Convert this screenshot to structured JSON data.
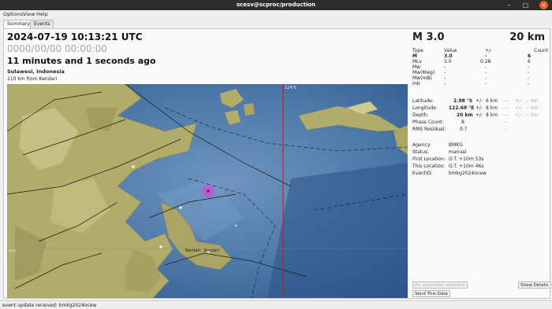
{
  "window": {
    "title": "scesv@scproc/production",
    "controls": {
      "minimize": "–",
      "maximize": "▢",
      "close": "×"
    }
  },
  "menu": {
    "items": [
      "Options",
      "View",
      "Help"
    ]
  },
  "tabs": [
    "Summary",
    "Events"
  ],
  "event": {
    "origin_time": "2024-07-19 10:13:21 UTC",
    "secondary_time": "0000/00/00  00:00:00",
    "elapsed": "11 minutes and 1 seconds ago",
    "region": "Sulawesi, Indonesia",
    "nearest_city": "110 km from Kendari"
  },
  "summary": {
    "magnitude_label": "M 3.0",
    "depth_label": "20 km"
  },
  "magnitudes": {
    "headers": {
      "type": "Type",
      "value": "Value",
      "pm": "+/-",
      "count": "Count"
    },
    "rows": [
      {
        "type": "M",
        "value": "3.0",
        "pm": "-",
        "count": "6",
        "bold": true
      },
      {
        "type": "MLv",
        "value": "3.0",
        "pm": "0.28",
        "count": "6",
        "bold": false
      },
      {
        "type": "Mw",
        "value": "-",
        "pm": "-",
        "count": "-",
        "bold": false
      },
      {
        "type": "Mw(Mwp)",
        "value": "-",
        "pm": "-",
        "count": "-",
        "bold": false
      },
      {
        "type": "Mw(mB)",
        "value": "-",
        "pm": "-",
        "count": "-",
        "bold": false
      },
      {
        "type": "mb",
        "value": "-",
        "pm": "-",
        "count": "-",
        "bold": false
      }
    ]
  },
  "origin_info": {
    "latitude": {
      "label": "Latitude:",
      "value": "2.98 °S",
      "pm": "+/-",
      "err": "6 km",
      "ref_value": "----",
      "ref_pm": "+/-",
      "ref_err": "-- km"
    },
    "longitude": {
      "label": "Longitude:",
      "value": "122.68 °E",
      "pm": "+/-",
      "err": "8 km",
      "ref_value": "----",
      "ref_pm": "+/-",
      "ref_err": "-- km"
    },
    "depth": {
      "label": "Depth:",
      "value": "20 km",
      "pm": "+/-",
      "err": "8 km",
      "ref_value": "----",
      "ref_pm": "+/-",
      "ref_err": "-- km"
    },
    "phase_count": {
      "label": "Phase Count:",
      "value": "8",
      "ref_value": "--"
    },
    "rms": {
      "label": "RMS Residual:",
      "value": "0.7",
      "ref_value": "--"
    }
  },
  "meta": {
    "agency": {
      "label": "Agency:",
      "value": "BMKG"
    },
    "status": {
      "label": "Status:",
      "value": "manual"
    },
    "first_location": {
      "label": "First Location:",
      "value": "O.T. +10m 53s"
    },
    "this_location": {
      "label": "This Location:",
      "value": "O.T. +10m 46s"
    },
    "event_id": {
      "label": "EventID:",
      "value": "bmkg2024ocew"
    }
  },
  "buttons": {
    "fix_auto": "Fix automatic solutions",
    "show_details": "Show Details",
    "send_data": "Send This Data"
  },
  "map": {
    "grid_label_lon": "124°E",
    "grid_label_lat": "4°S",
    "city_labels": [
      "Kendari",
      "Kendari"
    ],
    "colors": {
      "sea": "#3f6a9e",
      "land": "#b1ac6a",
      "epicenter": "#d23cdc",
      "meridian": "#d01414"
    }
  },
  "statusbar": {
    "text": "event update received: bmkg2024ocew"
  }
}
